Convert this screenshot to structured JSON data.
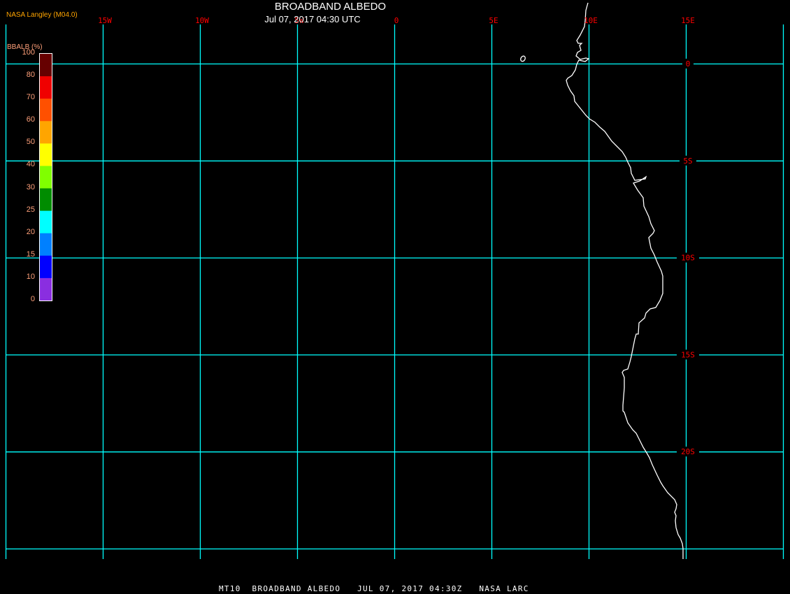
{
  "header": {
    "title": "BROADBAND ALBEDO",
    "subtitle": "Jul 07, 2017 04:30 UTC",
    "credit": "NASA Langley (M04.0)"
  },
  "footer": "MT10  BROADBAND ALBEDO   JUL 07, 2017 04:30Z   NASA LARC",
  "map": {
    "grid_color": "#00ffff",
    "label_color": "#ff0000",
    "coastline_color": "#ffffff",
    "longitude_labels": [
      "15W",
      "10W",
      "5W",
      "0",
      "5E",
      "10E",
      "15E"
    ],
    "latitude_labels": [
      "0",
      "5S",
      "10S",
      "15S",
      "20S"
    ]
  },
  "legend": {
    "title": "BBALB (%)",
    "tick_labels": [
      "100",
      "80",
      "70",
      "60",
      "50",
      "40",
      "30",
      "25",
      "20",
      "15",
      "10",
      "0"
    ],
    "colors": [
      "#660000",
      "#f00000",
      "#ff5000",
      "#ffa500",
      "#ffff00",
      "#80ff00",
      "#008c00",
      "#00ffff",
      "#0080ff",
      "#0000ff",
      "#8a2ee0"
    ]
  }
}
